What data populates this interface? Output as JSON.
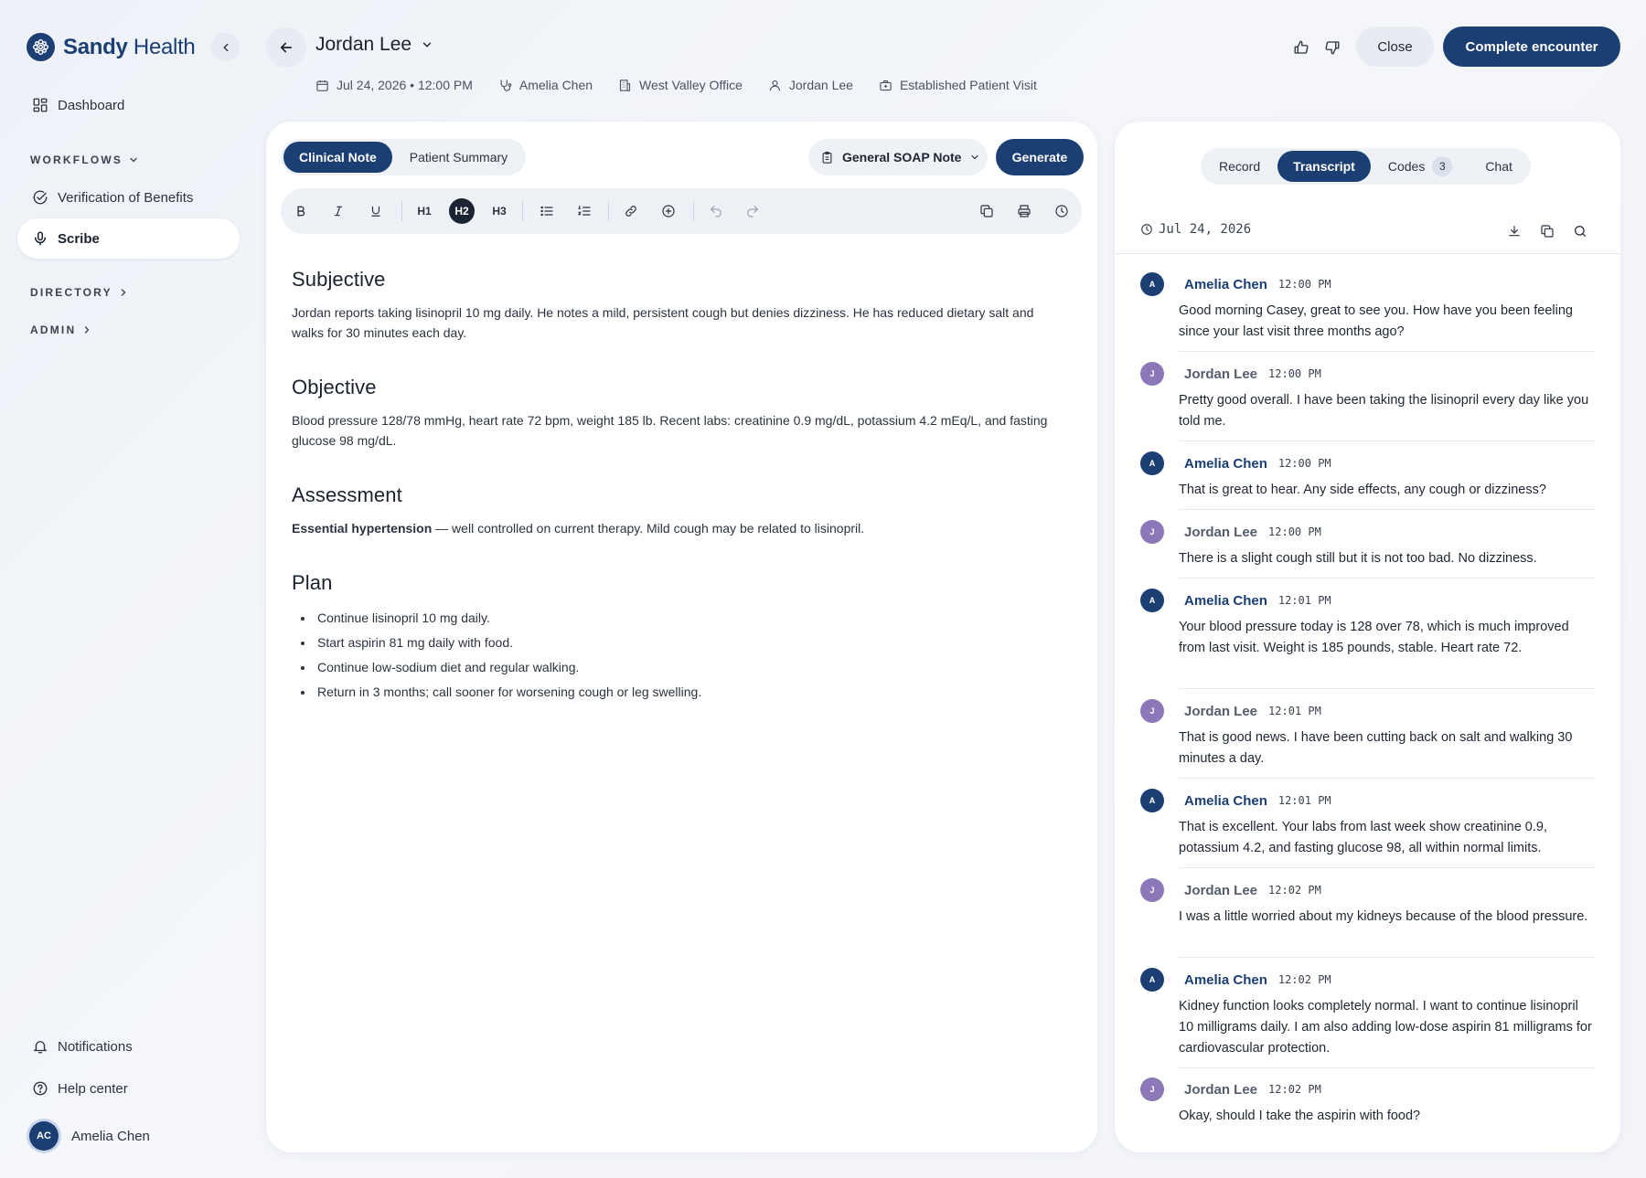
{
  "brand": {
    "name_bold": "Sandy",
    "name_rest": "Health"
  },
  "sidebar": {
    "dashboard": "Dashboard",
    "workflows_label": "WORKFLOWS",
    "verification": "Verification of Benefits",
    "scribe": "Scribe",
    "directory_label": "DIRECTORY",
    "admin_label": "ADMIN",
    "notifications": "Notifications",
    "help": "Help center",
    "user_initials": "AC",
    "user_name": "Amelia Chen"
  },
  "header": {
    "patient_name": "Jordan Lee",
    "meta": {
      "datetime": "Jul 24, 2026 • 12:00 PM",
      "clinician": "Amelia Chen",
      "location": "West Valley Office",
      "patient": "Jordan Lee",
      "visit_type": "Established Patient Visit"
    },
    "close_label": "Close",
    "complete_label": "Complete encounter"
  },
  "note_panel": {
    "tabs": [
      "Clinical Note",
      "Patient Summary"
    ],
    "template": "General SOAP Note",
    "generate_label": "Generate",
    "toolbar": {
      "h1": "H1",
      "h2": "H2",
      "h3": "H3"
    },
    "sections": {
      "subjective": {
        "heading": "Subjective",
        "text": "Jordan reports taking lisinopril 10 mg daily. He notes a mild, persistent cough but denies dizziness. He has reduced dietary salt and walks for 30 minutes each day."
      },
      "objective": {
        "heading": "Objective",
        "text": "Blood pressure 128/78 mmHg, heart rate 72 bpm, weight 185 lb. Recent labs: creatinine 0.9 mg/dL, potassium 4.2 mEq/L, and fasting glucose 98 mg/dL."
      },
      "assessment": {
        "heading": "Assessment",
        "bold": "Essential hypertension",
        "text": " — well controlled on current therapy. Mild cough may be related to lisinopril."
      },
      "plan": {
        "heading": "Plan",
        "items": [
          "Continue lisinopril 10 mg daily.",
          "Start aspirin 81 mg daily with food.",
          "Continue low-sodium diet and regular walking.",
          "Return in 3 months; call sooner for worsening cough or leg swelling."
        ]
      }
    }
  },
  "transcript_panel": {
    "tabs": {
      "record": "Record",
      "transcript": "Transcript",
      "codes": "Codes",
      "codes_count": "3",
      "chat": "Chat"
    },
    "date": "Jul 24, 2026",
    "messages": [
      {
        "initial": "A",
        "speaker": "Amelia Chen",
        "time": "12:00 PM",
        "text": "Good morning Casey, great to see you. How have you been feeling since your last visit three months ago?"
      },
      {
        "initial": "J",
        "speaker": "Jordan Lee",
        "time": "12:00 PM",
        "text": "Pretty good overall. I have been taking the lisinopril every day like you told me."
      },
      {
        "initial": "A",
        "speaker": "Amelia Chen",
        "time": "12:00 PM",
        "text": "That is great to hear. Any side effects, any cough or dizziness?"
      },
      {
        "initial": "J",
        "speaker": "Jordan Lee",
        "time": "12:00 PM",
        "text": "There is a slight cough still but it is not too bad. No dizziness."
      },
      {
        "initial": "A",
        "speaker": "Amelia Chen",
        "time": "12:01 PM",
        "text": "Your blood pressure today is 128 over 78, which is much improved from last visit. Weight is 185 pounds, stable. Heart rate 72."
      },
      {
        "initial": "J",
        "speaker": "Jordan Lee",
        "time": "12:01 PM",
        "text": "That is good news. I have been cutting back on salt and walking 30 minutes a day."
      },
      {
        "initial": "A",
        "speaker": "Amelia Chen",
        "time": "12:01 PM",
        "text": "That is excellent. Your labs from last week show creatinine 0.9, potassium 4.2, and fasting glucose 98, all within normal limits."
      },
      {
        "initial": "J",
        "speaker": "Jordan Lee",
        "time": "12:02 PM",
        "text": "I was a little worried about my kidneys because of the blood pressure."
      },
      {
        "initial": "A",
        "speaker": "Amelia Chen",
        "time": "12:02 PM",
        "text": "Kidney function looks completely normal. I want to continue lisinopril 10 milligrams daily. I am also adding low-dose aspirin 81 milligrams for cardiovascular protection."
      },
      {
        "initial": "J",
        "speaker": "Jordan Lee",
        "time": "12:02 PM",
        "text": "Okay, should I take the aspirin with food?"
      }
    ]
  },
  "colors": {
    "brand": "#1c3f73",
    "patient_avatar": "#8a78b8",
    "panel_bg": "#ffffff",
    "control_bg": "#eef2f7"
  }
}
